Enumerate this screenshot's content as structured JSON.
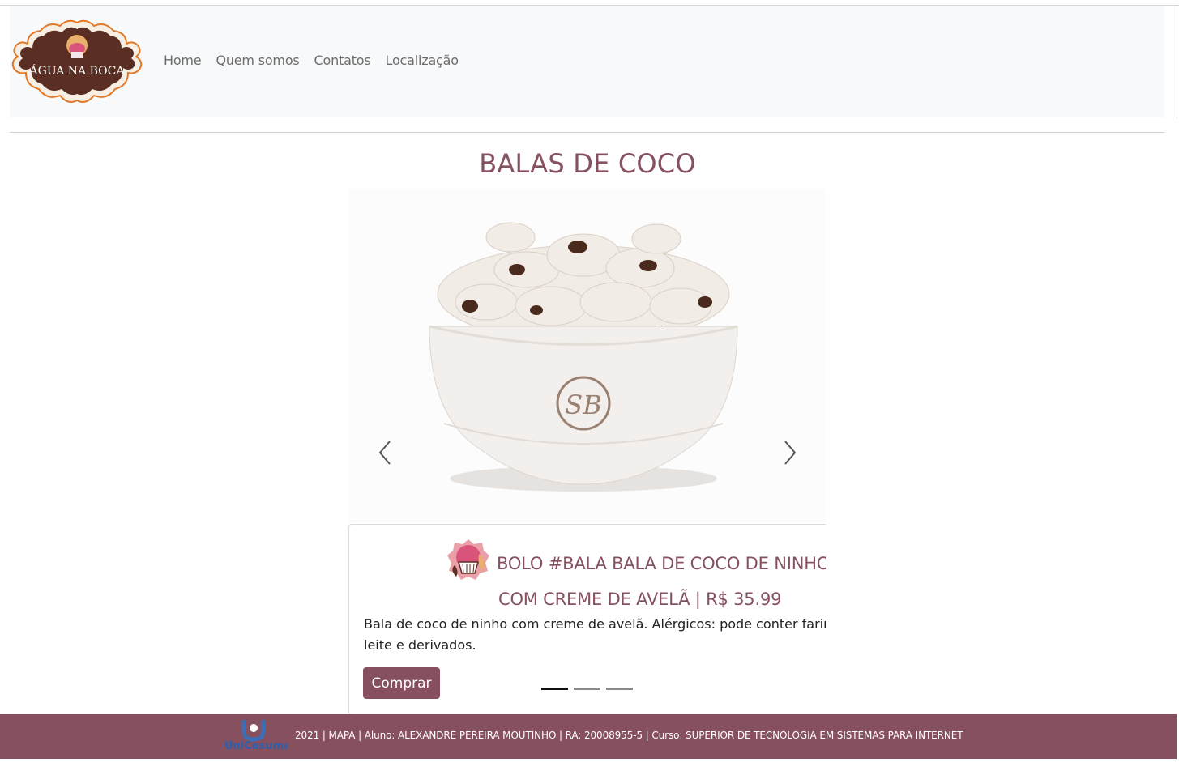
{
  "brand": {
    "name": "ÁGUA NA BOCA"
  },
  "nav": {
    "items": [
      "Home",
      "Quem somos",
      "Contatos",
      "Localização"
    ]
  },
  "page": {
    "title": "BALAS DE COCO"
  },
  "carousel": {
    "image_alt": "Balas de coco em tigela",
    "prev_icon": "chevron-left-icon",
    "next_icon": "chevron-right-icon",
    "active_index": 0,
    "slide_count": 3
  },
  "card": {
    "title_line1": "BOLO #BALA BALA DE COCO DE NINHO",
    "title_line2": "COM CREME DE AVELÃ | R$ 35.99",
    "text_line1": "Bala de coco de ninho com creme de avelã. Alérgicos: pode conter farinha de trigo,",
    "text_line2": "leite e derivados.",
    "button": "Comprar"
  },
  "footer": {
    "logo_text": "UniCesumar",
    "text": "2021 | MAPA | Aluno: ALEXANDRE PEREIRA MOUTINHO | RA: 20008955-5 | Curso: SUPERIOR DE TECNOLOGIA EM SISTEMAS PARA INTERNET"
  },
  "colors": {
    "brand": "#86505f",
    "navbar_bg": "#f8f9fa",
    "logo_brown": "#5a2e22",
    "logo_orange": "#e07a2a"
  }
}
